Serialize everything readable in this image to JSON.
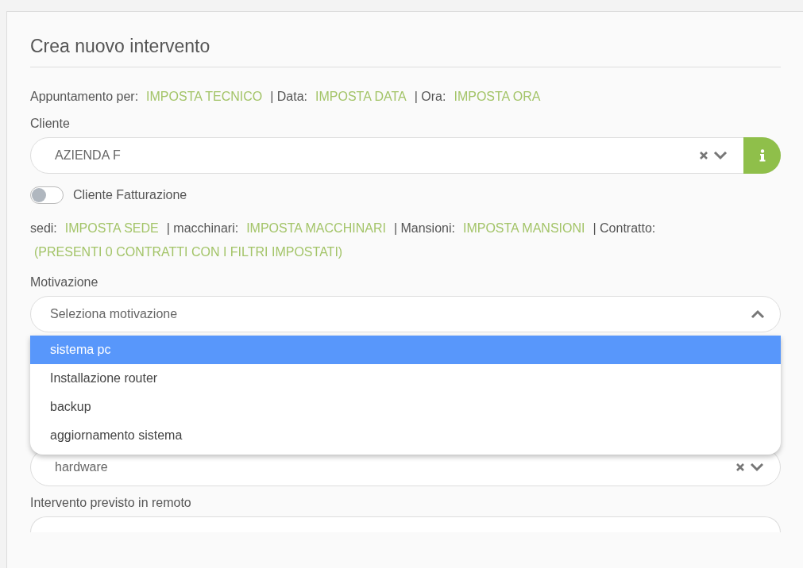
{
  "title": "Crea nuovo intervento",
  "appointment": [
    {
      "label": "Appuntamento per:",
      "value": "IMPOSTA TECNICO"
    },
    {
      "label": "| Data:",
      "value": "IMPOSTA DATA"
    },
    {
      "label": "| Ora:",
      "value": "IMPOSTA ORA"
    }
  ],
  "cliente": {
    "label": "Cliente",
    "value": "AZIENDA F"
  },
  "toggle": {
    "label": "Cliente Fatturazione",
    "on": false
  },
  "filters": [
    {
      "label": "sedi:",
      "value": "IMPOSTA SEDE"
    },
    {
      "label": "| macchinari:",
      "value": "IMPOSTA MACCHINARI"
    },
    {
      "label": "| Mansioni:",
      "value": "IMPOSTA MANSIONI"
    },
    {
      "label": "| Contratto:"
    }
  ],
  "contract_note": "(PRESENTI 0 CONTRATTI CON I FILTRI IMPOSTATI)",
  "motivazione": {
    "label": "Motivazione",
    "placeholder": "Seleziona motivazione",
    "expanded": true,
    "options": [
      {
        "label": "sistema pc",
        "selected": true
      },
      {
        "label": "Installazione router",
        "selected": false
      },
      {
        "label": "backup",
        "selected": false
      },
      {
        "label": "aggiornamento sistema",
        "selected": false
      }
    ]
  },
  "hardware_field": {
    "value": "hardware"
  },
  "remoto": {
    "label": "Intervento previsto in remoto"
  }
}
